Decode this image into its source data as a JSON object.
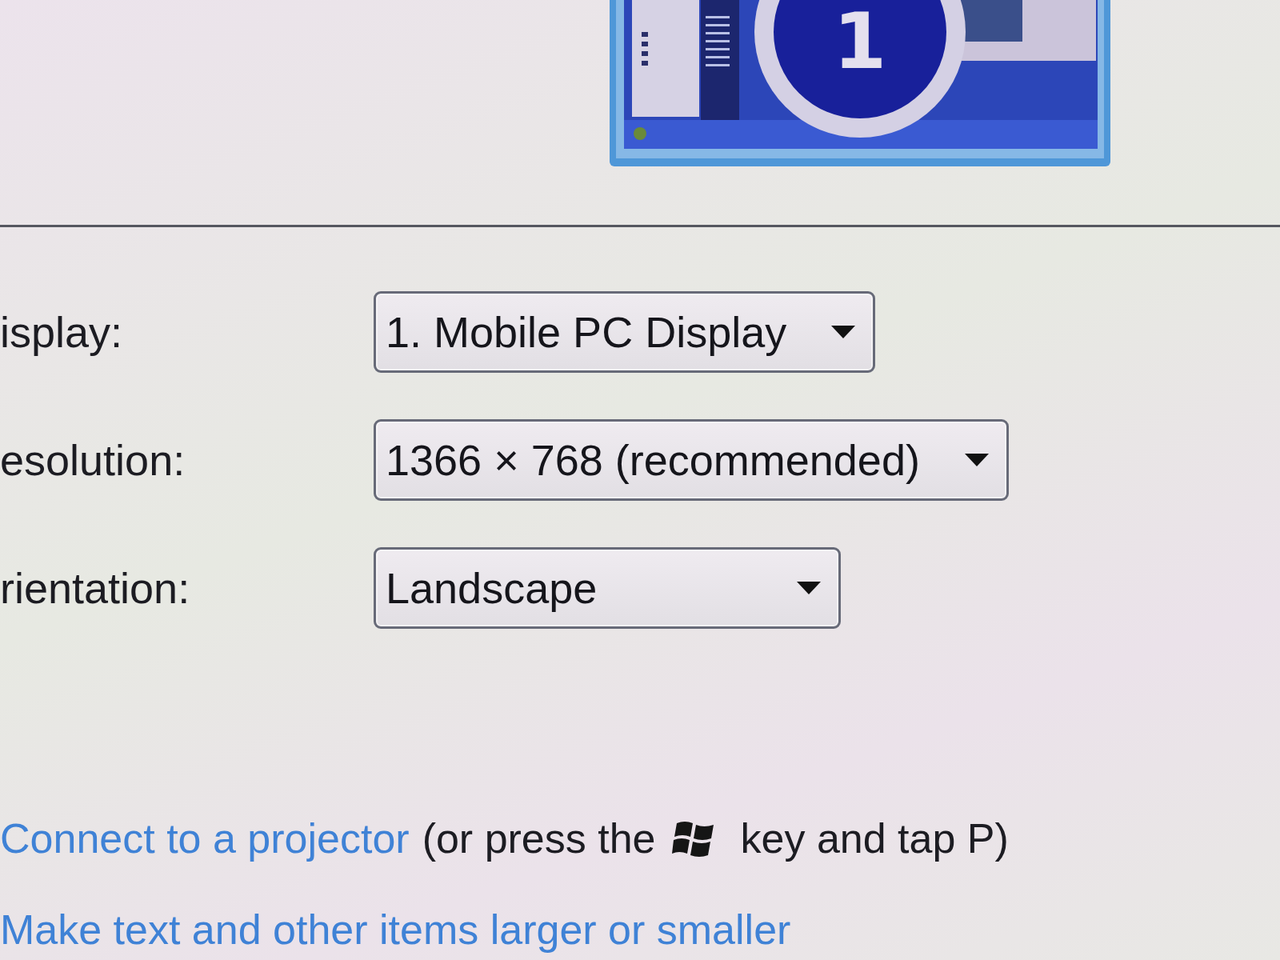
{
  "monitor_preview": {
    "number": "1"
  },
  "settings": [
    {
      "label": "isplay:",
      "value": "1. Mobile PC Display"
    },
    {
      "label": "esolution:",
      "value": "1366 × 768 (recommended)"
    },
    {
      "label": "rientation:",
      "value": "Landscape"
    }
  ],
  "projector_hint": {
    "link": "Connect to a projector",
    "before_key": "(or press the",
    "after_key": "key and tap P)"
  },
  "text_size_link": "Make text and other items larger or smaller"
}
